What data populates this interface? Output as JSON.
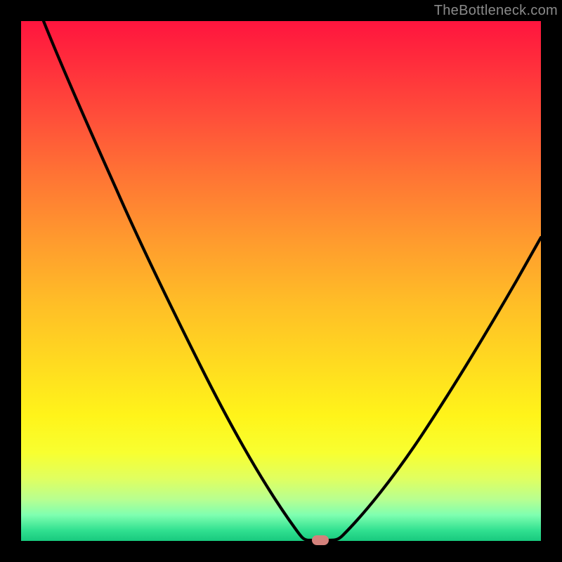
{
  "watermark": "TheBottleneck.com",
  "colors": {
    "frame": "#000000",
    "curve": "#000000",
    "marker": "#d4817b"
  },
  "chart_data": {
    "type": "line",
    "title": "",
    "xlabel": "",
    "ylabel": "",
    "xlim": [
      0,
      100
    ],
    "ylim": [
      0,
      100
    ],
    "x": [
      0,
      5,
      10,
      15,
      20,
      25,
      30,
      35,
      40,
      45,
      50,
      54,
      55,
      56,
      58,
      60,
      65,
      70,
      75,
      80,
      85,
      90,
      95,
      100
    ],
    "values": [
      100,
      93,
      86,
      79,
      71,
      62,
      52,
      41,
      29,
      17,
      7,
      1,
      0,
      0,
      0,
      0.5,
      3,
      8,
      14,
      22,
      30,
      39,
      49,
      59
    ],
    "flat_bottom_x_range": [
      54,
      59
    ],
    "marker_x": 57,
    "marker_y": 0
  }
}
